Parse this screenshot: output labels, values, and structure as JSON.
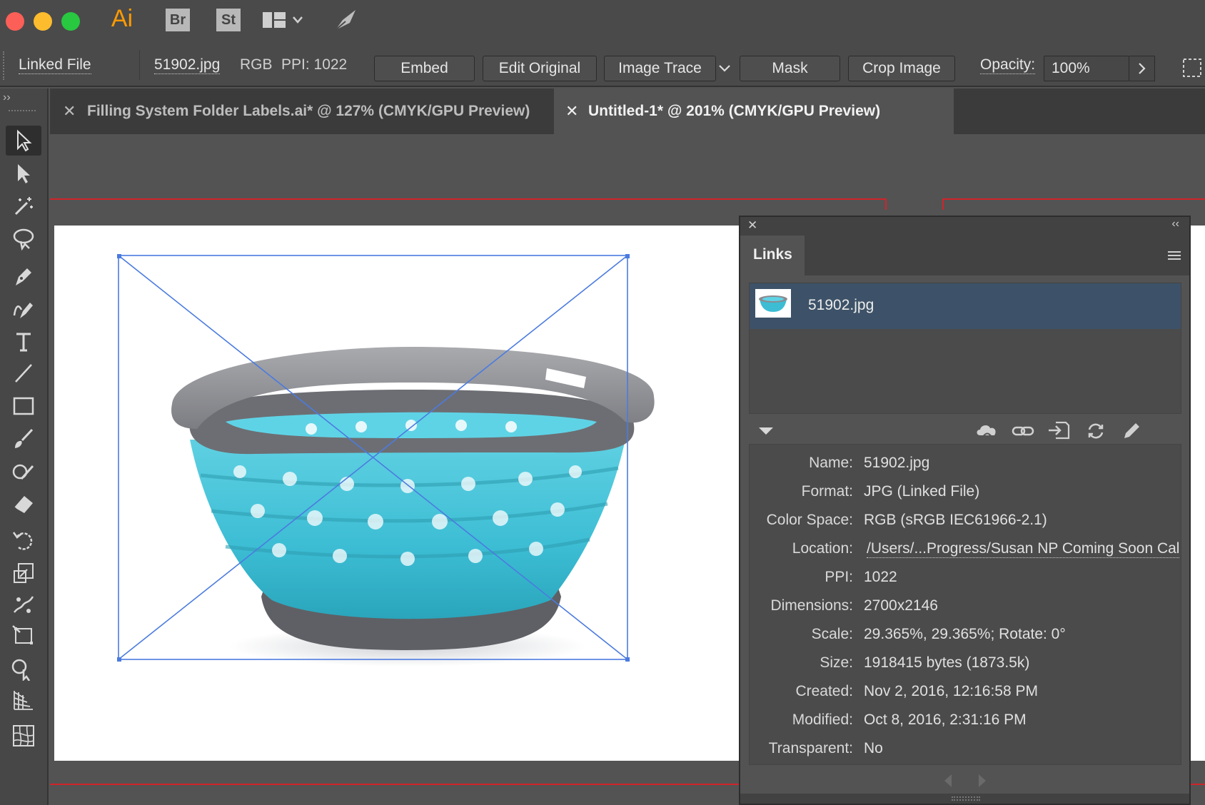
{
  "app": {
    "badge_ai": "Ai",
    "badge_br": "Br",
    "badge_st": "St",
    "accent": "#ff9a00"
  },
  "control_bar": {
    "linked_file": "Linked File",
    "filename": "51902.jpg",
    "color_mode": "RGB",
    "ppi": "PPI: 1022",
    "embed": "Embed",
    "edit_original": "Edit Original",
    "image_trace": "Image Trace",
    "mask": "Mask",
    "crop_image": "Crop Image",
    "opacity_label": "Opacity:",
    "opacity_value": "100%"
  },
  "tabs": [
    {
      "label": "Filling System Folder Labels.ai* @ 127% (CMYK/GPU Preview)",
      "active": false
    },
    {
      "label": "Untitled-1* @ 201% (CMYK/GPU Preview)",
      "active": true
    }
  ],
  "links_panel": {
    "title": "Links",
    "item_name": "51902.jpg",
    "info": [
      {
        "label": "Name:",
        "value": "51902.jpg"
      },
      {
        "label": "Format:",
        "value": "JPG (Linked File)"
      },
      {
        "label": "Color Space:",
        "value": "RGB (sRGB IEC61966-2.1)"
      },
      {
        "label": "Location:",
        "value": "/Users/...Progress/Susan NP Coming Soon Cal"
      },
      {
        "label": "PPI:",
        "value": "1022"
      },
      {
        "label": "Dimensions:",
        "value": "2700x2146"
      },
      {
        "label": "Scale:",
        "value": "29.365%, 29.365%; Rotate: 0°"
      },
      {
        "label": "Size:",
        "value": "1918415 bytes (1873.5k)"
      },
      {
        "label": "Created:",
        "value": "Nov 2, 2016, 12:16:58 PM"
      },
      {
        "label": "Modified:",
        "value": "Oct 8, 2016, 2:31:16 PM"
      },
      {
        "label": "Transparent:",
        "value": "No"
      }
    ]
  },
  "colors": {
    "selection": "#4b7be0",
    "artboard_guide": "#d0242a",
    "panel_selected_row": "#3d5268"
  }
}
